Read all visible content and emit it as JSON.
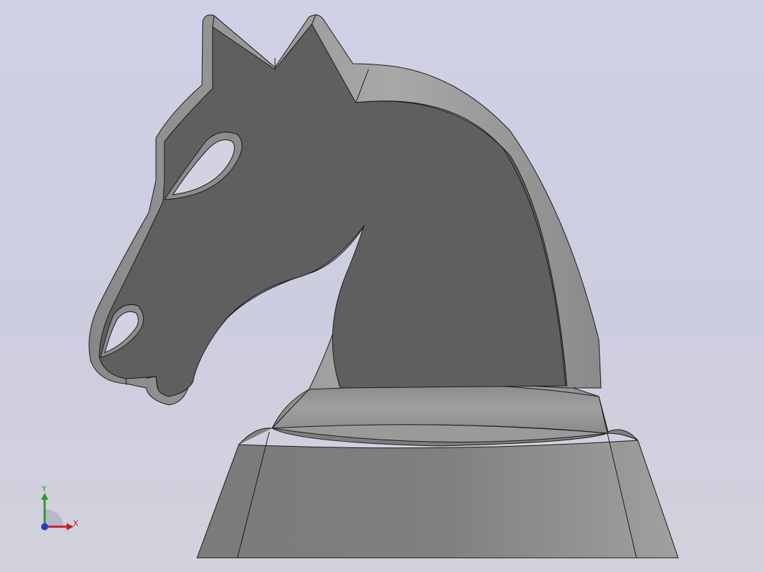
{
  "viewport": {
    "background_top": "#d0d0e6",
    "background_bottom": "#d2d2dc",
    "model_color": "#6a6a6a",
    "edge_color": "#1a1a1a"
  },
  "model": {
    "name": "knight-chess-piece"
  },
  "triad": {
    "x_label": "X",
    "y_label": "Y",
    "x_color": "#c0202a",
    "y_color": "#2a9a2a",
    "origin_color": "#2040c0"
  }
}
